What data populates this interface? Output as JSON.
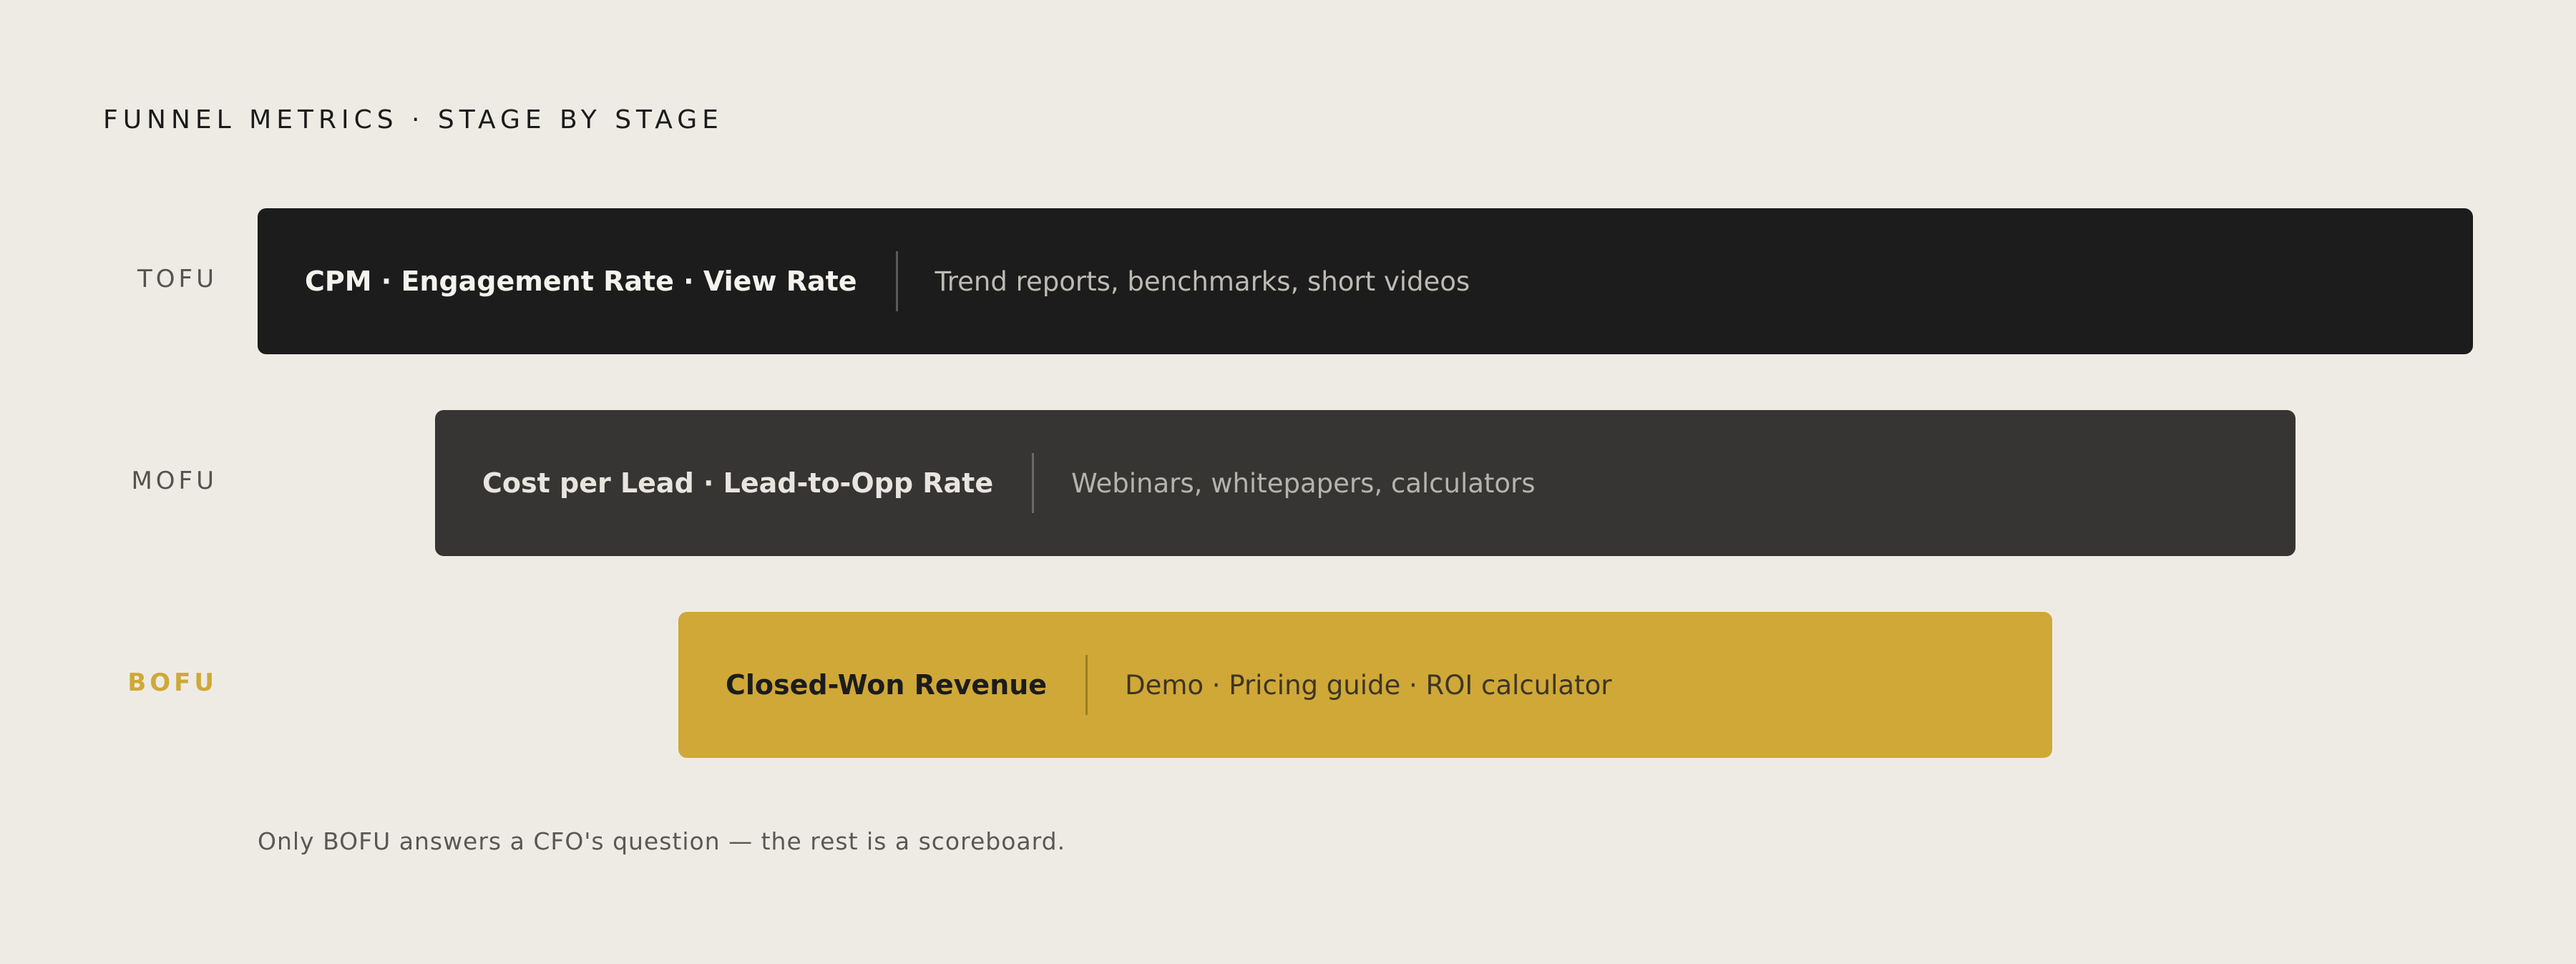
{
  "title": "FUNNEL METRICS · STAGE BY STAGE",
  "stages": [
    {
      "label": "TOFU",
      "metrics": "CPM · Engagement Rate · View Rate",
      "assets": "Trend reports, benchmarks, short videos",
      "color": "#1c1c1c"
    },
    {
      "label": "MOFU",
      "metrics": "Cost per Lead · Lead-to-Opp Rate",
      "assets": "Webinars, whitepapers, calculators",
      "color": "#363534"
    },
    {
      "label": "BOFU",
      "metrics": "Closed-Won Revenue",
      "assets": "Demo · Pricing guide · ROI calculator",
      "color": "#cfa837"
    }
  ],
  "footnote": "Only BOFU answers a CFO's question — the rest is a scoreboard.",
  "colors": {
    "background": "#eeebe5",
    "accent": "#cfa837"
  }
}
